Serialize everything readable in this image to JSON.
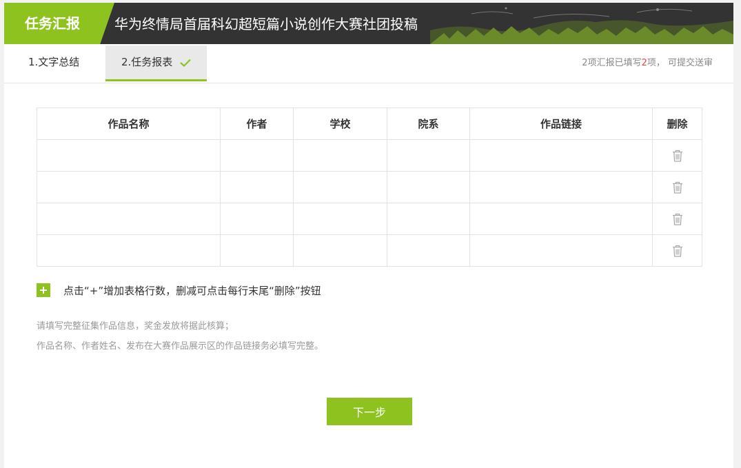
{
  "header": {
    "badge": "任务汇报",
    "title": "华为终情局首届科幻超短篇小说创作大赛社团投稿"
  },
  "tabs": [
    {
      "label": "1.文字总结"
    },
    {
      "label": "2.任务报表"
    }
  ],
  "status": {
    "prefix": "2项汇报已填写",
    "count": "2",
    "suffix": "项， 可提交送审"
  },
  "table": {
    "headers": [
      "作品名称",
      "作者",
      "学校",
      "院系",
      "作品链接",
      "删除"
    ],
    "rows": [
      [
        "",
        "",
        "",
        "",
        ""
      ],
      [
        "",
        "",
        "",
        "",
        ""
      ],
      [
        "",
        "",
        "",
        "",
        ""
      ],
      [
        "",
        "",
        "",
        "",
        ""
      ]
    ]
  },
  "add_hint": "点击“+”增加表格行数，删减可点击每行末尾“删除”按钮",
  "notes": [
    "请填写完整征集作品信息，奖金发放将据此核算；",
    "作品名称、作者姓名、发布在大赛作品展示区的作品链接务必填写完整。"
  ],
  "next_button": "下一步",
  "colors": {
    "accent": "#8dc21f",
    "header_bg": "#333333",
    "count_red": "#e8413a"
  }
}
